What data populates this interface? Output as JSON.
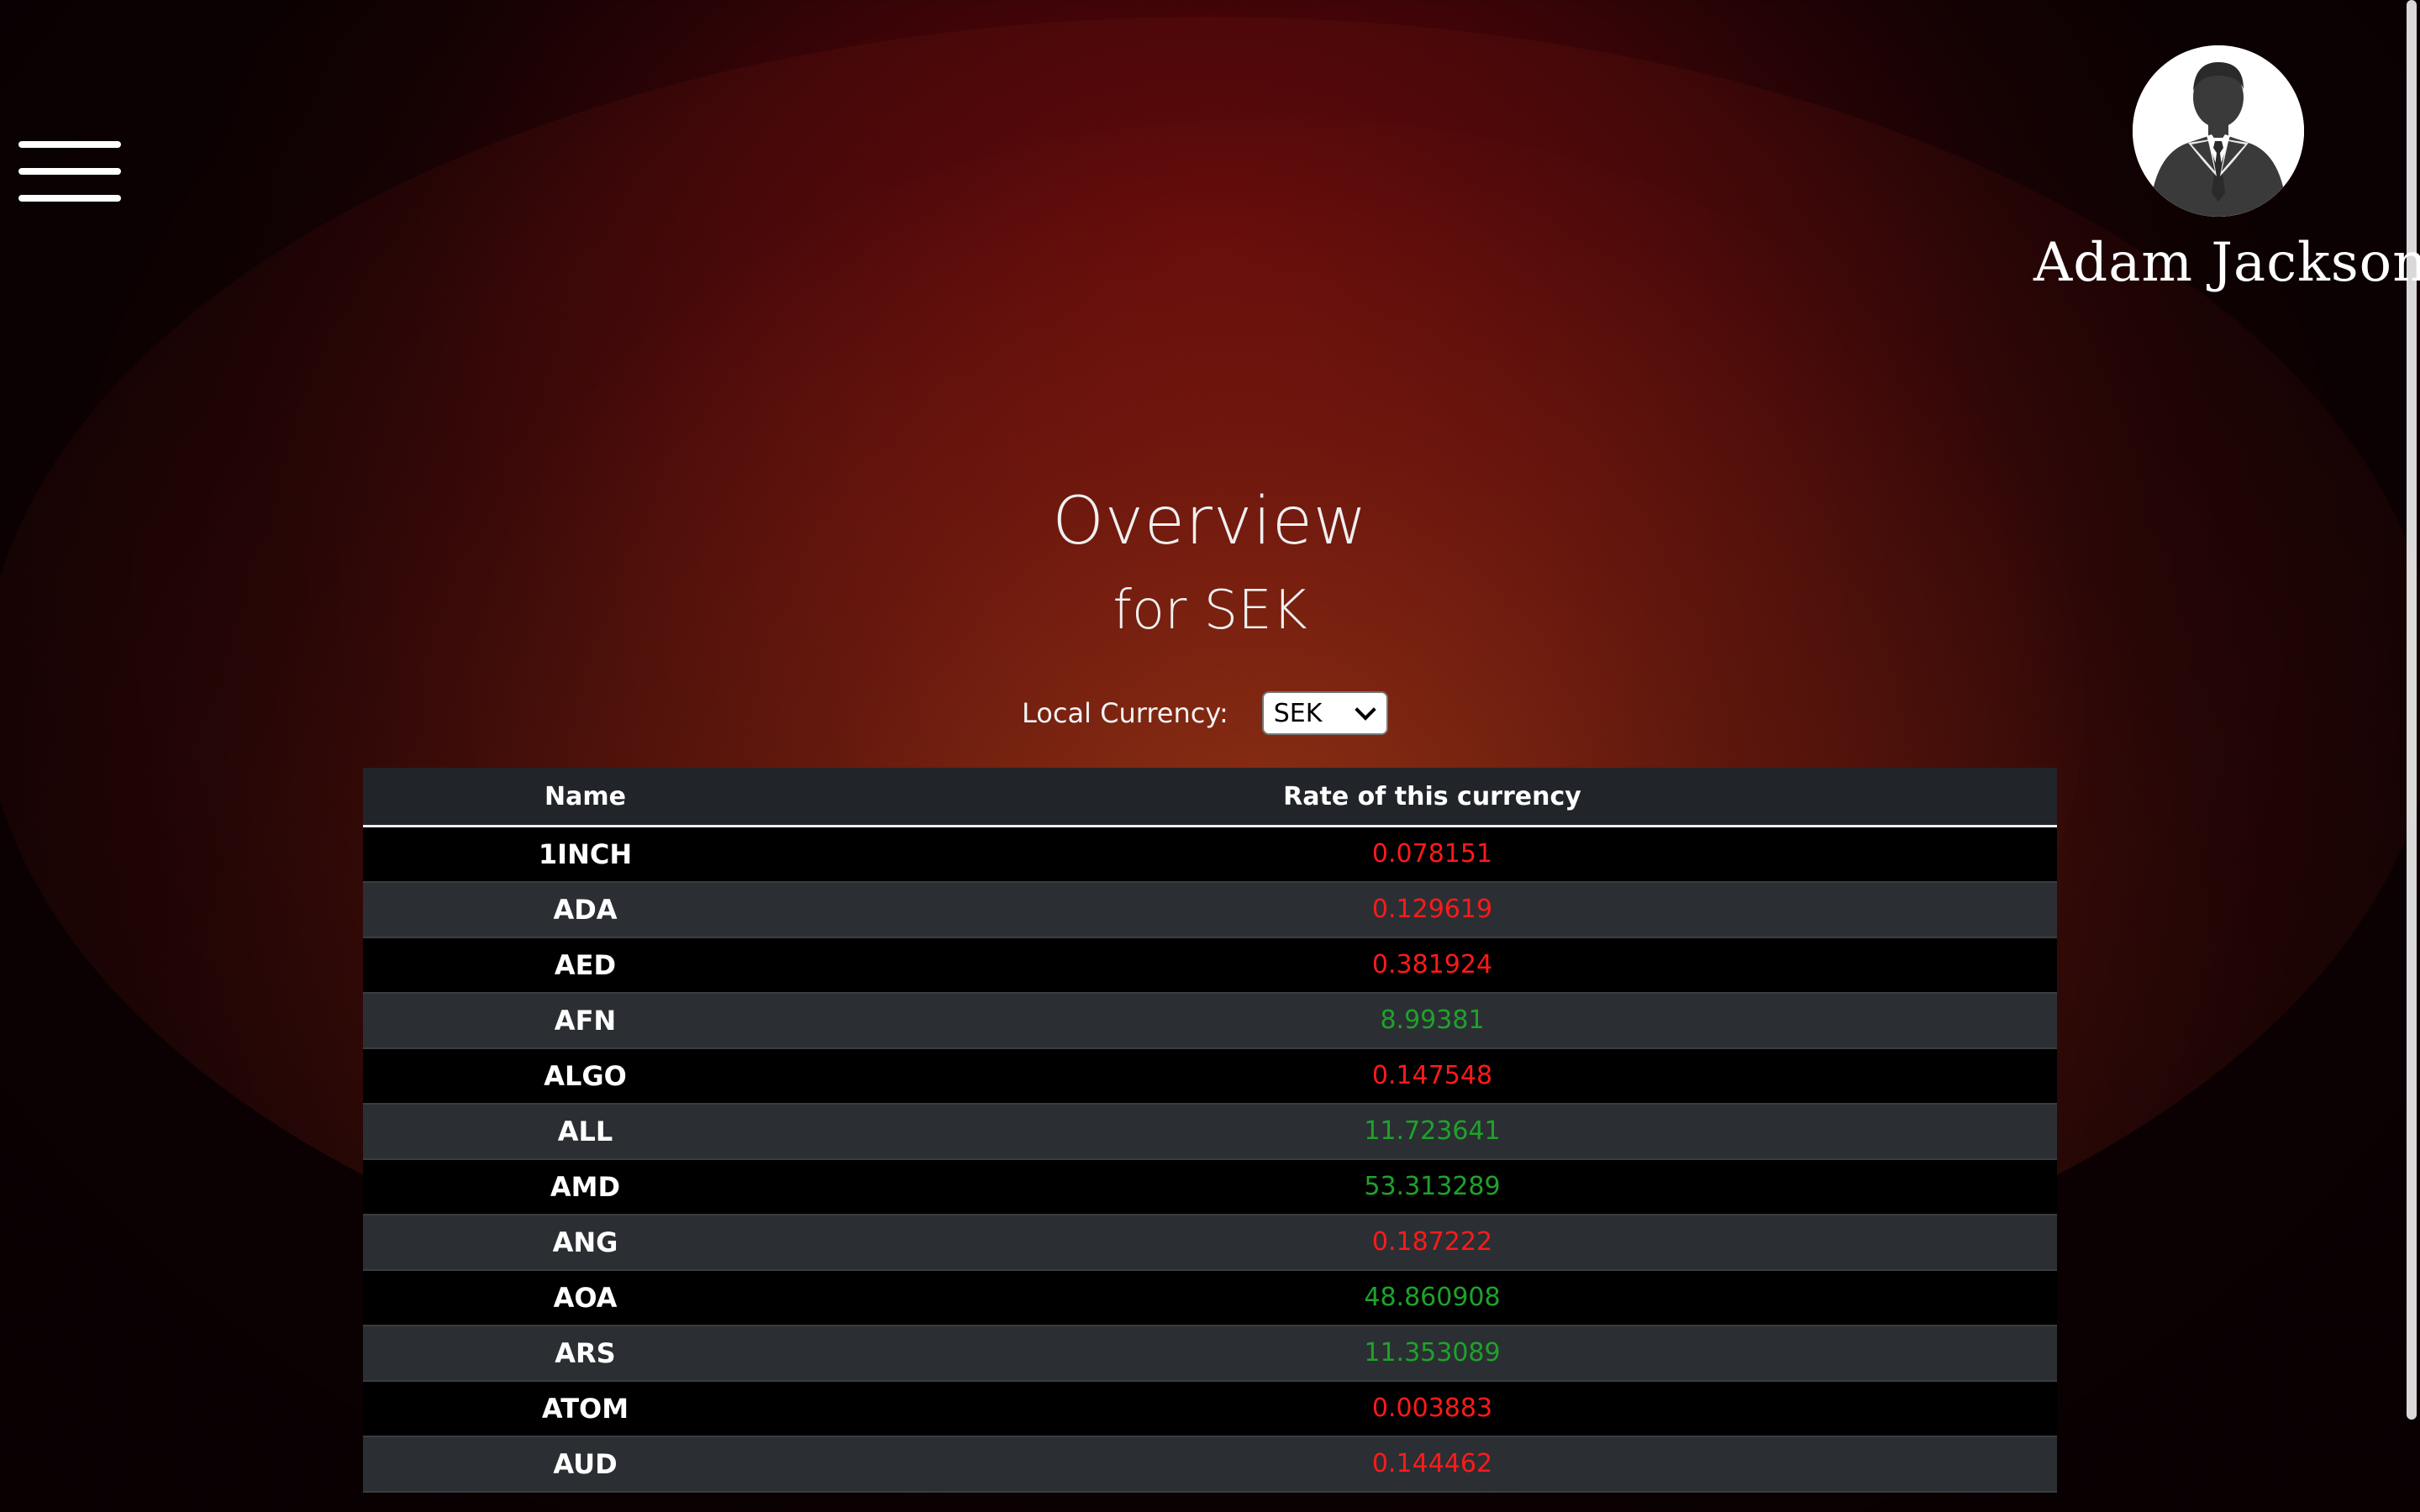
{
  "colors": {
    "rate_down": "#ff1a1a",
    "rate_up": "#1fa22b",
    "header_bg": "#212529"
  },
  "nav": {
    "menu_icon": "hamburger-menu-icon"
  },
  "profile": {
    "avatar_icon": "business-person-silhouette",
    "name": "Adam Jackson"
  },
  "overview": {
    "title": "Overview",
    "subtitle": "for SEK"
  },
  "currency_selector": {
    "label": "Local Currency:",
    "selected": "SEK"
  },
  "table": {
    "headers": [
      "Name",
      "Rate of this currency"
    ],
    "rows": [
      {
        "name": "1INCH",
        "rate": "0.078151",
        "trend": "down"
      },
      {
        "name": "ADA",
        "rate": "0.129619",
        "trend": "down"
      },
      {
        "name": "AED",
        "rate": "0.381924",
        "trend": "down"
      },
      {
        "name": "AFN",
        "rate": "8.99381",
        "trend": "up"
      },
      {
        "name": "ALGO",
        "rate": "0.147548",
        "trend": "down"
      },
      {
        "name": "ALL",
        "rate": "11.723641",
        "trend": "up"
      },
      {
        "name": "AMD",
        "rate": "53.313289",
        "trend": "up"
      },
      {
        "name": "ANG",
        "rate": "0.187222",
        "trend": "down"
      },
      {
        "name": "AOA",
        "rate": "48.860908",
        "trend": "up"
      },
      {
        "name": "ARS",
        "rate": "11.353089",
        "trend": "up"
      },
      {
        "name": "ATOM",
        "rate": "0.003883",
        "trend": "down"
      },
      {
        "name": "AUD",
        "rate": "0.144462",
        "trend": "down"
      }
    ]
  }
}
